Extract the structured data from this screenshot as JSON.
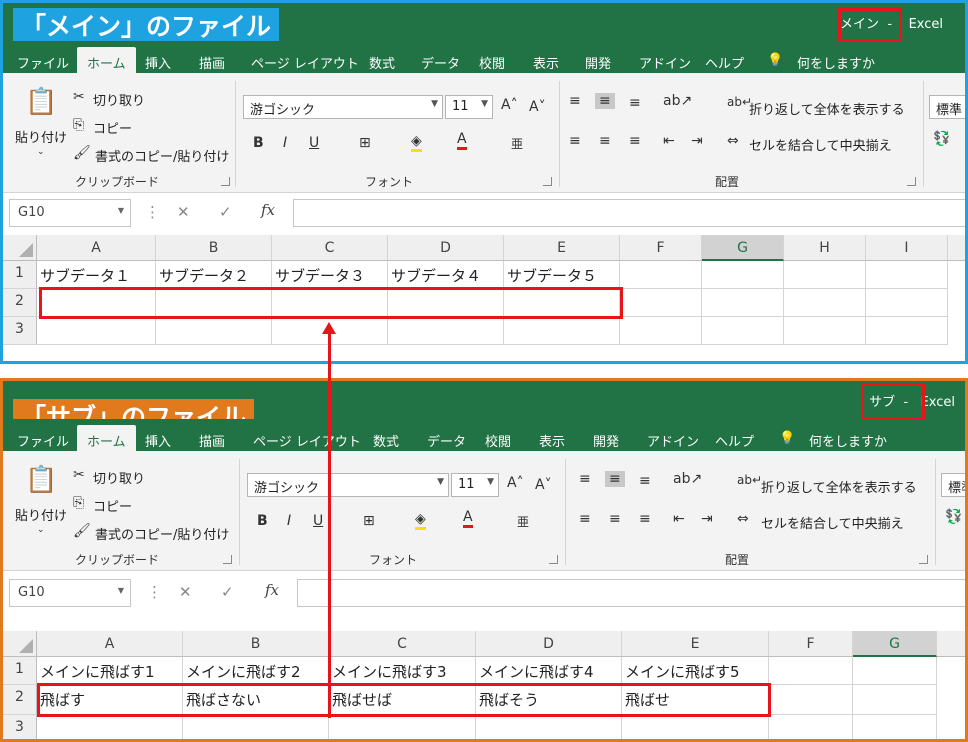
{
  "main": {
    "caption": "「メイン」のファイル",
    "title_name": "メイン",
    "title_sep": "-",
    "title_app": "Excel",
    "tabs": [
      "ファイル",
      "ホーム",
      "挿入",
      "描画",
      "ページ レイアウト",
      "数式",
      "データ",
      "校閲",
      "表示",
      "開発",
      "アドイン",
      "ヘルプ",
      "何をしますか"
    ],
    "ribbon": {
      "paste": "貼り付け",
      "cut": "切り取り",
      "copy": "コピー",
      "format_painter": "書式のコピー/貼り付け",
      "clipboard_group": "クリップボード",
      "font_name": "游ゴシック",
      "font_size": "11",
      "font_group": "フォント",
      "wrap_text": "折り返して全体を表示する",
      "merge_center": "セルを結合して中央揃え",
      "align_group": "配置",
      "number_format": "標準"
    },
    "name_box": "G10",
    "columns": [
      "A",
      "B",
      "C",
      "D",
      "E",
      "F",
      "G",
      "H",
      "I"
    ],
    "rows": [
      "1",
      "2",
      "3"
    ],
    "cells_row1": [
      "サブデータ１",
      "サブデータ２",
      "サブデータ３",
      "サブデータ４",
      "サブデータ５"
    ],
    "cells_row2": [
      "",
      "",
      "",
      "",
      ""
    ]
  },
  "sub": {
    "caption": "「サブ」のファイル",
    "title_name": "サブ",
    "title_sep": "-",
    "title_app": "Excel",
    "tabs": [
      "ファイル",
      "ホーム",
      "挿入",
      "描画",
      "ページ レイアウト",
      "数式",
      "データ",
      "校閲",
      "表示",
      "開発",
      "アドイン",
      "ヘルプ",
      "何をしますか"
    ],
    "ribbon": {
      "paste": "貼り付け",
      "cut": "切り取り",
      "copy": "コピー",
      "format_painter": "書式のコピー/貼り付け",
      "clipboard_group": "クリップボード",
      "font_name": "游ゴシック",
      "font_size": "11",
      "font_group": "フォント",
      "wrap_text": "折り返して全体を表示する",
      "merge_center": "セルを結合して中央揃え",
      "align_group": "配置",
      "number_format": "標準"
    },
    "name_box": "G10",
    "columns": [
      "A",
      "B",
      "C",
      "D",
      "E",
      "F",
      "G"
    ],
    "rows": [
      "1",
      "2",
      "3"
    ],
    "cells_row1": [
      "メインに飛ばす1",
      "メインに飛ばす2",
      "メインに飛ばす3",
      "メインに飛ばす4",
      "メインに飛ばす5"
    ],
    "cells_row2": [
      "飛ばす",
      "飛ばさない",
      "飛ばせば",
      "飛ばそう",
      "飛ばせ"
    ]
  },
  "colors": {
    "excel_green": "#217346",
    "main_frame": "#1fa3e0",
    "sub_frame": "#e07a1c",
    "highlight_red": "#e8141a"
  }
}
